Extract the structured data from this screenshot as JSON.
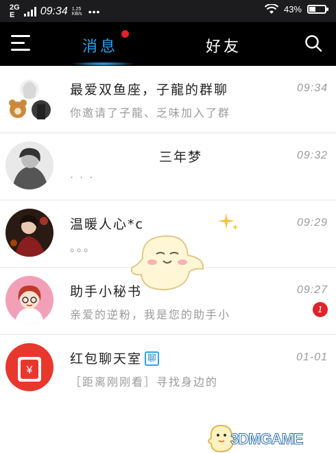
{
  "status_bar": {
    "network": "2G",
    "data_type": "E",
    "speed": "1.25",
    "speed_unit": "KB/s",
    "time": "09:34",
    "more": "•••",
    "battery": "43%",
    "battery_level": 0.43
  },
  "header": {
    "tab_messages": "消息",
    "tab_friends": "好友"
  },
  "conversations": [
    {
      "title": "最爱双鱼座，子龍的群聊",
      "preview": "你邀请了子龍、乏味加入了群",
      "time": "09:34"
    },
    {
      "title": "三年梦",
      "preview": "· · ·",
      "time": "09:32"
    },
    {
      "title": "温暖人心*c",
      "preview": "。。。",
      "time": "09:29"
    },
    {
      "title": "助手小秘书",
      "preview": "亲爱的逆粉，我是您的助手小",
      "time": "09:27",
      "badge": "1"
    },
    {
      "title": "红包聊天室",
      "tag": "聊",
      "preview": "［距离刚刚看］寻找身边的",
      "time": "01-01"
    }
  ],
  "watermark": "3DMGAME"
}
